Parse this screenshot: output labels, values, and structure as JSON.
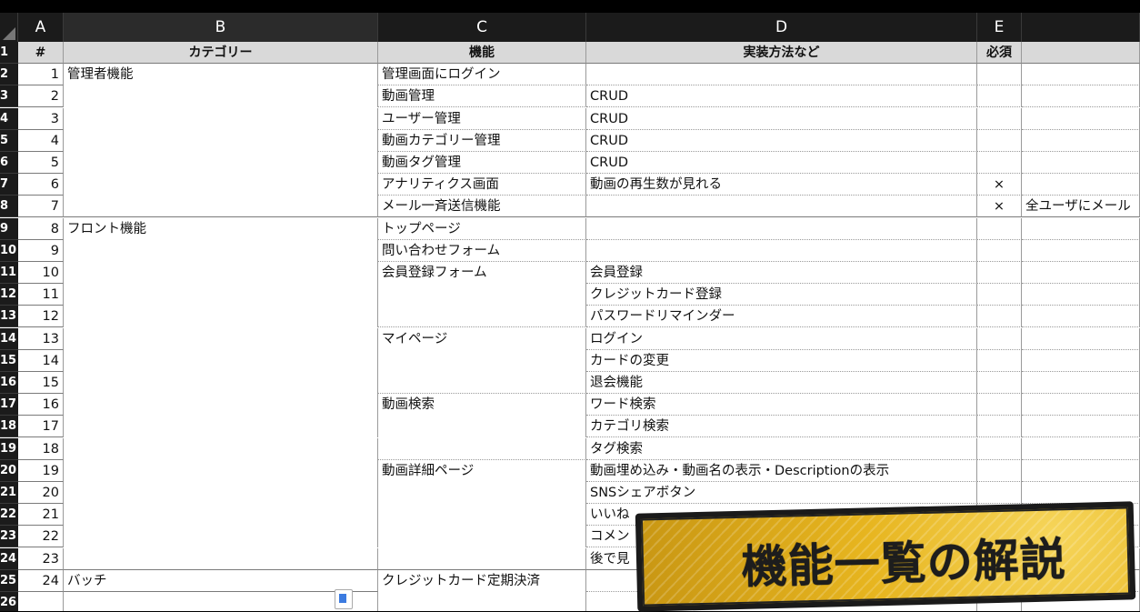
{
  "columns": [
    "A",
    "B",
    "C",
    "D",
    "E",
    ""
  ],
  "header": {
    "num": "#",
    "category": "カテゴリー",
    "feature": "機能",
    "method": "実装方法など",
    "required": "必須",
    "note": ""
  },
  "row_numbers": [
    "1",
    "2",
    "3",
    "4",
    "5",
    "6",
    "7",
    "8",
    "9",
    "10",
    "11",
    "12",
    "13",
    "14",
    "15",
    "16",
    "17",
    "18",
    "19",
    "20",
    "21",
    "22",
    "23",
    "24",
    "25",
    "26"
  ],
  "rows": [
    {
      "num": "1",
      "category": "管理者機能",
      "feature": "管理画面にログイン",
      "method": "",
      "required": "",
      "note": ""
    },
    {
      "num": "2",
      "category": "",
      "feature": "動画管理",
      "method": "CRUD",
      "required": "",
      "note": ""
    },
    {
      "num": "3",
      "category": "",
      "feature": "ユーザー管理",
      "method": "CRUD",
      "required": "",
      "note": ""
    },
    {
      "num": "4",
      "category": "",
      "feature": "動画カテゴリー管理",
      "method": "CRUD",
      "required": "",
      "note": ""
    },
    {
      "num": "5",
      "category": "",
      "feature": "動画タグ管理",
      "method": "CRUD",
      "required": "",
      "note": ""
    },
    {
      "num": "6",
      "category": "",
      "feature": "アナリティクス画面",
      "method": "動画の再生数が見れる",
      "required": "×",
      "note": ""
    },
    {
      "num": "7",
      "category": "",
      "feature": "メール一斉送信機能",
      "method": "",
      "required": "×",
      "note": "全ユーザにメール"
    },
    {
      "num": "8",
      "category": "フロント機能",
      "feature": "トップページ",
      "method": "",
      "required": "",
      "note": ""
    },
    {
      "num": "9",
      "category": "",
      "feature": "問い合わせフォーム",
      "method": "",
      "required": "",
      "note": ""
    },
    {
      "num": "10",
      "category": "",
      "feature": "会員登録フォーム",
      "method": "会員登録",
      "required": "",
      "note": ""
    },
    {
      "num": "11",
      "category": "",
      "feature": "",
      "method": "クレジットカード登録",
      "required": "",
      "note": ""
    },
    {
      "num": "12",
      "category": "",
      "feature": "",
      "method": "パスワードリマインダー",
      "required": "",
      "note": ""
    },
    {
      "num": "13",
      "category": "",
      "feature": "マイページ",
      "method": "ログイン",
      "required": "",
      "note": ""
    },
    {
      "num": "14",
      "category": "",
      "feature": "",
      "method": "カードの変更",
      "required": "",
      "note": ""
    },
    {
      "num": "15",
      "category": "",
      "feature": "",
      "method": "退会機能",
      "required": "",
      "note": ""
    },
    {
      "num": "16",
      "category": "",
      "feature": "動画検索",
      "method": "ワード検索",
      "required": "",
      "note": ""
    },
    {
      "num": "17",
      "category": "",
      "feature": "",
      "method": "カテゴリ検索",
      "required": "",
      "note": ""
    },
    {
      "num": "18",
      "category": "",
      "feature": "",
      "method": "タグ検索",
      "required": "",
      "note": ""
    },
    {
      "num": "19",
      "category": "",
      "feature": "動画詳細ページ",
      "method": "動画埋め込み・動画名の表示・Descriptionの表示",
      "required": "",
      "note": ""
    },
    {
      "num": "20",
      "category": "",
      "feature": "",
      "method": "SNSシェアボタン",
      "required": "",
      "note": ""
    },
    {
      "num": "21",
      "category": "",
      "feature": "",
      "method": "いいね",
      "required": "",
      "note": ""
    },
    {
      "num": "22",
      "category": "",
      "feature": "",
      "method": "コメン",
      "required": "",
      "note": ""
    },
    {
      "num": "23",
      "category": "",
      "feature": "",
      "method": "後で見",
      "required": "",
      "note": ""
    },
    {
      "num": "24",
      "category": "バッチ",
      "feature": "クレジットカード定期決済",
      "method": "",
      "required": "",
      "note": ""
    },
    {
      "num": "",
      "category": "",
      "feature": "",
      "method": "",
      "required": "",
      "note": ""
    }
  ],
  "banner": {
    "text": "機能一覧の解説"
  },
  "colors": {
    "header_bg": "#1b1b1b",
    "table_header_bg": "#d9d9d9",
    "banner_bg": "#e7b51f"
  }
}
